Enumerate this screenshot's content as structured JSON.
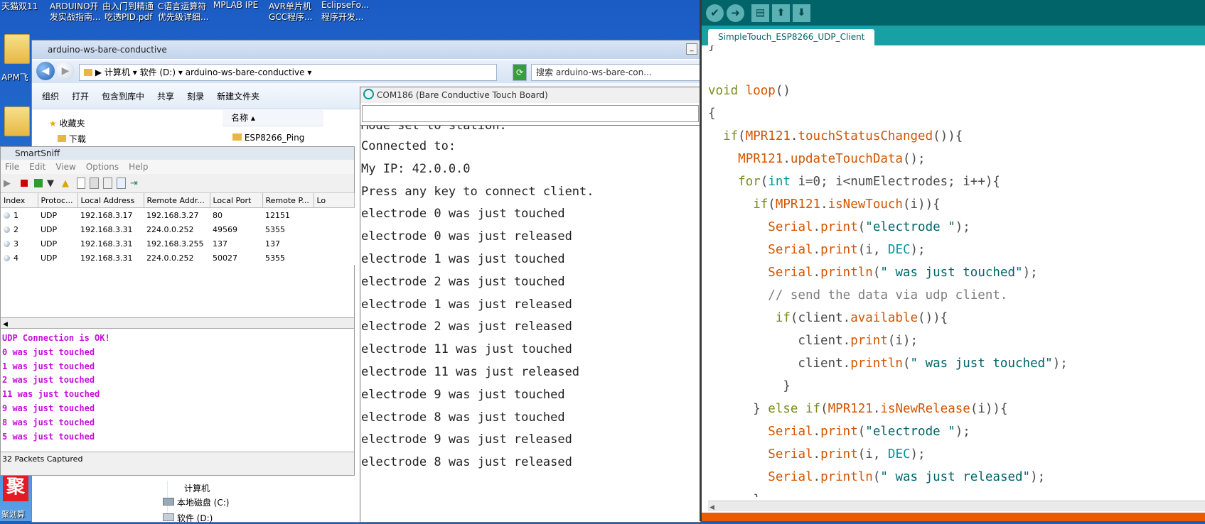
{
  "desktop": {
    "top_labels": [
      {
        "text": "天猫双11"
      },
      {
        "text": "ARDUINO开"
      },
      {
        "text": "由入门到精通"
      },
      {
        "text": "C语言运算符"
      },
      {
        "text": "MPLAB IPE"
      },
      {
        "text": "AVR单片机"
      },
      {
        "text": "EclipseFo..."
      }
    ],
    "second_labels": [
      {
        "text": "发实战指南..."
      },
      {
        "text": "吃透PID.pdf"
      },
      {
        "text": "优先级详细..."
      },
      {
        "text": "GCC程序..."
      },
      {
        "text": "程序开发..."
      }
    ],
    "left_label": "APM飞",
    "bottom_left_label": "聚划算"
  },
  "explorer": {
    "title": "arduino-ws-bare-conductive",
    "breadcrumb": [
      "计算机",
      "软件 (D:)",
      "arduino-ws-bare-conductive"
    ],
    "search_placeholder": "搜索 arduino-ws-bare-con...",
    "toolbar": [
      "组织",
      "打开",
      "包含到库中",
      "共享",
      "刻录",
      "新建文件夹"
    ],
    "nav": {
      "favorites": "收藏夹",
      "downloads": "下载"
    },
    "column_name": "名称",
    "file_item": "ESP8266_Ping",
    "tree": {
      "computer": "计算机",
      "drive_c": "本地磁盘 (C:)",
      "drive_d": "软件 (D:)"
    }
  },
  "smartsniff": {
    "title": "SmartSniff",
    "menu": [
      "File",
      "Edit",
      "View",
      "Options",
      "Help"
    ],
    "columns": [
      "Index",
      "Protoc...",
      "Local Address",
      "Remote Addr...",
      "Local Port",
      "Remote P...",
      "Lo"
    ],
    "rows": [
      [
        "1",
        "UDP",
        "192.168.3.17",
        "192.168.3.27",
        "80",
        "12151"
      ],
      [
        "2",
        "UDP",
        "192.168.3.31",
        "224.0.0.252",
        "49569",
        "5355"
      ],
      [
        "3",
        "UDP",
        "192.168.3.31",
        "192.168.3.255",
        "137",
        "137"
      ],
      [
        "4",
        "UDP",
        "192.168.3.31",
        "224.0.0.252",
        "50027",
        "5355"
      ]
    ],
    "log": [
      "UDP Connection is OK!",
      "0 was just touched",
      "1 was just touched",
      "2 was just touched",
      "11 was just touched",
      "9 was just touched",
      "8 was just touched",
      "5 was just touched"
    ],
    "status": "32 Packets Captured"
  },
  "serial": {
    "title": "COM186 (Bare Conductive Touch Board)",
    "partial_top": "Mode set to station.",
    "lines": [
      "Connected to:",
      "My IP: 42.0.0.0",
      "",
      "Press any key to connect client.",
      "",
      "electrode 0 was just touched",
      "electrode 0 was just released",
      "electrode 1 was just touched",
      "electrode 2 was just touched",
      "electrode 1 was just released",
      "electrode 2 was just released",
      "electrode 11 was just touched",
      "electrode 11 was just released",
      "electrode 9 was just touched",
      "electrode 8 was just touched",
      "electrode 9 was just released",
      "electrode 8 was just released"
    ]
  },
  "arduino": {
    "tab": "SimpleTouch_ESP8266_UDP_Client",
    "toolbar": [
      {
        "icon": "verify-icon",
        "glyph": "✔"
      },
      {
        "icon": "upload-icon",
        "glyph": "➜"
      },
      {
        "icon": "new-icon",
        "glyph": "▤"
      },
      {
        "icon": "open-icon",
        "glyph": "⬆"
      },
      {
        "icon": "save-icon",
        "glyph": "⬇"
      }
    ],
    "accent": "#006468",
    "code_lines": [
      "}",
      "",
      "void loop()",
      "{",
      "  if(MPR121.touchStatusChanged()){",
      "    MPR121.updateTouchData();",
      "    for(int i=0; i<numElectrodes; i++){",
      "      if(MPR121.isNewTouch(i)){",
      "        Serial.print(\"electrode \");",
      "        Serial.print(i, DEC);",
      "        Serial.println(\" was just touched\");",
      "        // send the data via udp client.",
      "         if(client.available()){",
      "            client.print(i);",
      "            client.println(\" was just touched\");",
      "          }",
      "      } else if(MPR121.isNewRelease(i)){",
      "        Serial.print(\"electrode \");",
      "        Serial.print(i, DEC);",
      "        Serial.println(\" was just released\");",
      "      }"
    ]
  }
}
